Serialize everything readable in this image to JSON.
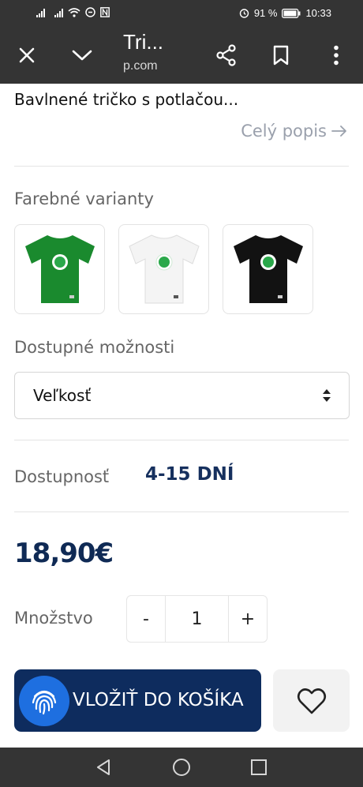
{
  "status_bar": {
    "battery_text": "91 %",
    "time": "10:33"
  },
  "browser": {
    "title": "Tri...",
    "url": "p.com"
  },
  "product": {
    "description": "Bavlnené tričko s potlačou...",
    "full_description_link": "Celý popis"
  },
  "variants": {
    "label": "Farebné varianty",
    "items": [
      {
        "color": "#1a8a2e"
      },
      {
        "color": "#f4f4f4"
      },
      {
        "color": "#121212"
      }
    ]
  },
  "options": {
    "label": "Dostupné možnosti",
    "select_value": "Veľkosť"
  },
  "availability": {
    "label": "Dostupnosť",
    "value": "4-15 DNÍ"
  },
  "price": "18,90€",
  "quantity": {
    "label": "Množstvo",
    "minus": "-",
    "value": "1",
    "plus": "+"
  },
  "actions": {
    "add_to_cart": "VLOŽIŤ DO KOŠÍKA"
  },
  "colors": {
    "brand_navy": "#0e2c5e",
    "fingerprint_blue": "#1e6fe0",
    "system_bar": "#343434"
  }
}
